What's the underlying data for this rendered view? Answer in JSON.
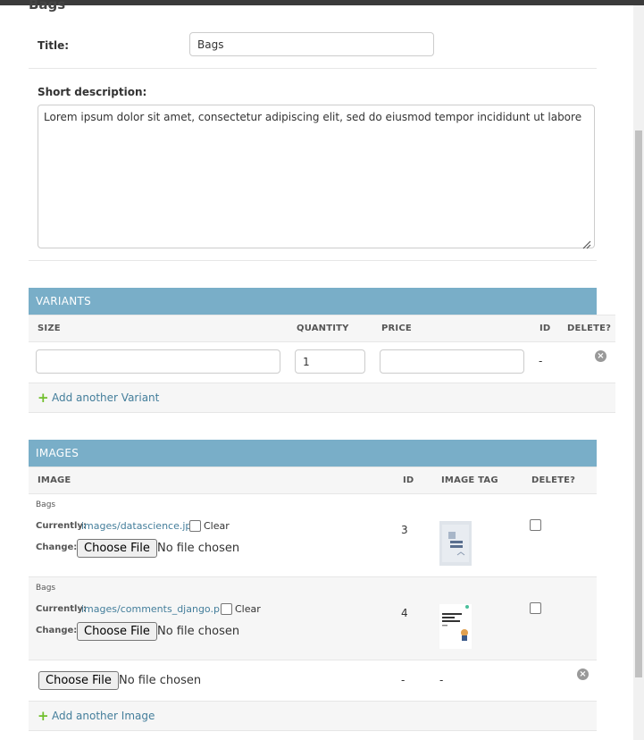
{
  "page_heading": "Bags",
  "form": {
    "title_label": "Title:",
    "title_value": "Bags",
    "short_description_label": "Short description:",
    "short_description_value": "Lorem ipsum dolor sit amet, consectetur adipiscing elit, sed do eiusmod tempor incididunt ut labore"
  },
  "variants": {
    "caption": "VARIANTS",
    "headers": {
      "size": "SIZE",
      "quantity": "QUANTITY",
      "price": "PRICE",
      "id": "ID",
      "delete": "DELETE?"
    },
    "row": {
      "size": "",
      "quantity": "1",
      "price": "",
      "id": "-"
    },
    "add_label": "Add another Variant"
  },
  "images": {
    "caption": "IMAGES",
    "headers": {
      "image": "IMAGE",
      "id": "ID",
      "image_tag": "IMAGE TAG",
      "delete": "DELETE?"
    },
    "rows": [
      {
        "title": "Bags",
        "currently_label": "Currently:",
        "currently_link": "images/datascience.jpg",
        "clear_label": "Clear",
        "change_label": "Change:",
        "button_label": "Choose File",
        "no_file": "No file chosen",
        "id": "3"
      },
      {
        "title": "Bags",
        "currently_label": "Currently:",
        "currently_link": "images/comments_django.png",
        "clear_label": "Clear",
        "change_label": "Change:",
        "button_label": "Choose File",
        "no_file": "No file chosen",
        "id": "4"
      }
    ],
    "empty_row": {
      "button_label": "Choose File",
      "no_file": "No file chosen",
      "id": "-",
      "image_tag": "-"
    },
    "add_label": "Add another Image"
  },
  "colors": {
    "module_header": "#79aec8",
    "link": "#447e9b",
    "add_icon": "#70bf2b"
  }
}
